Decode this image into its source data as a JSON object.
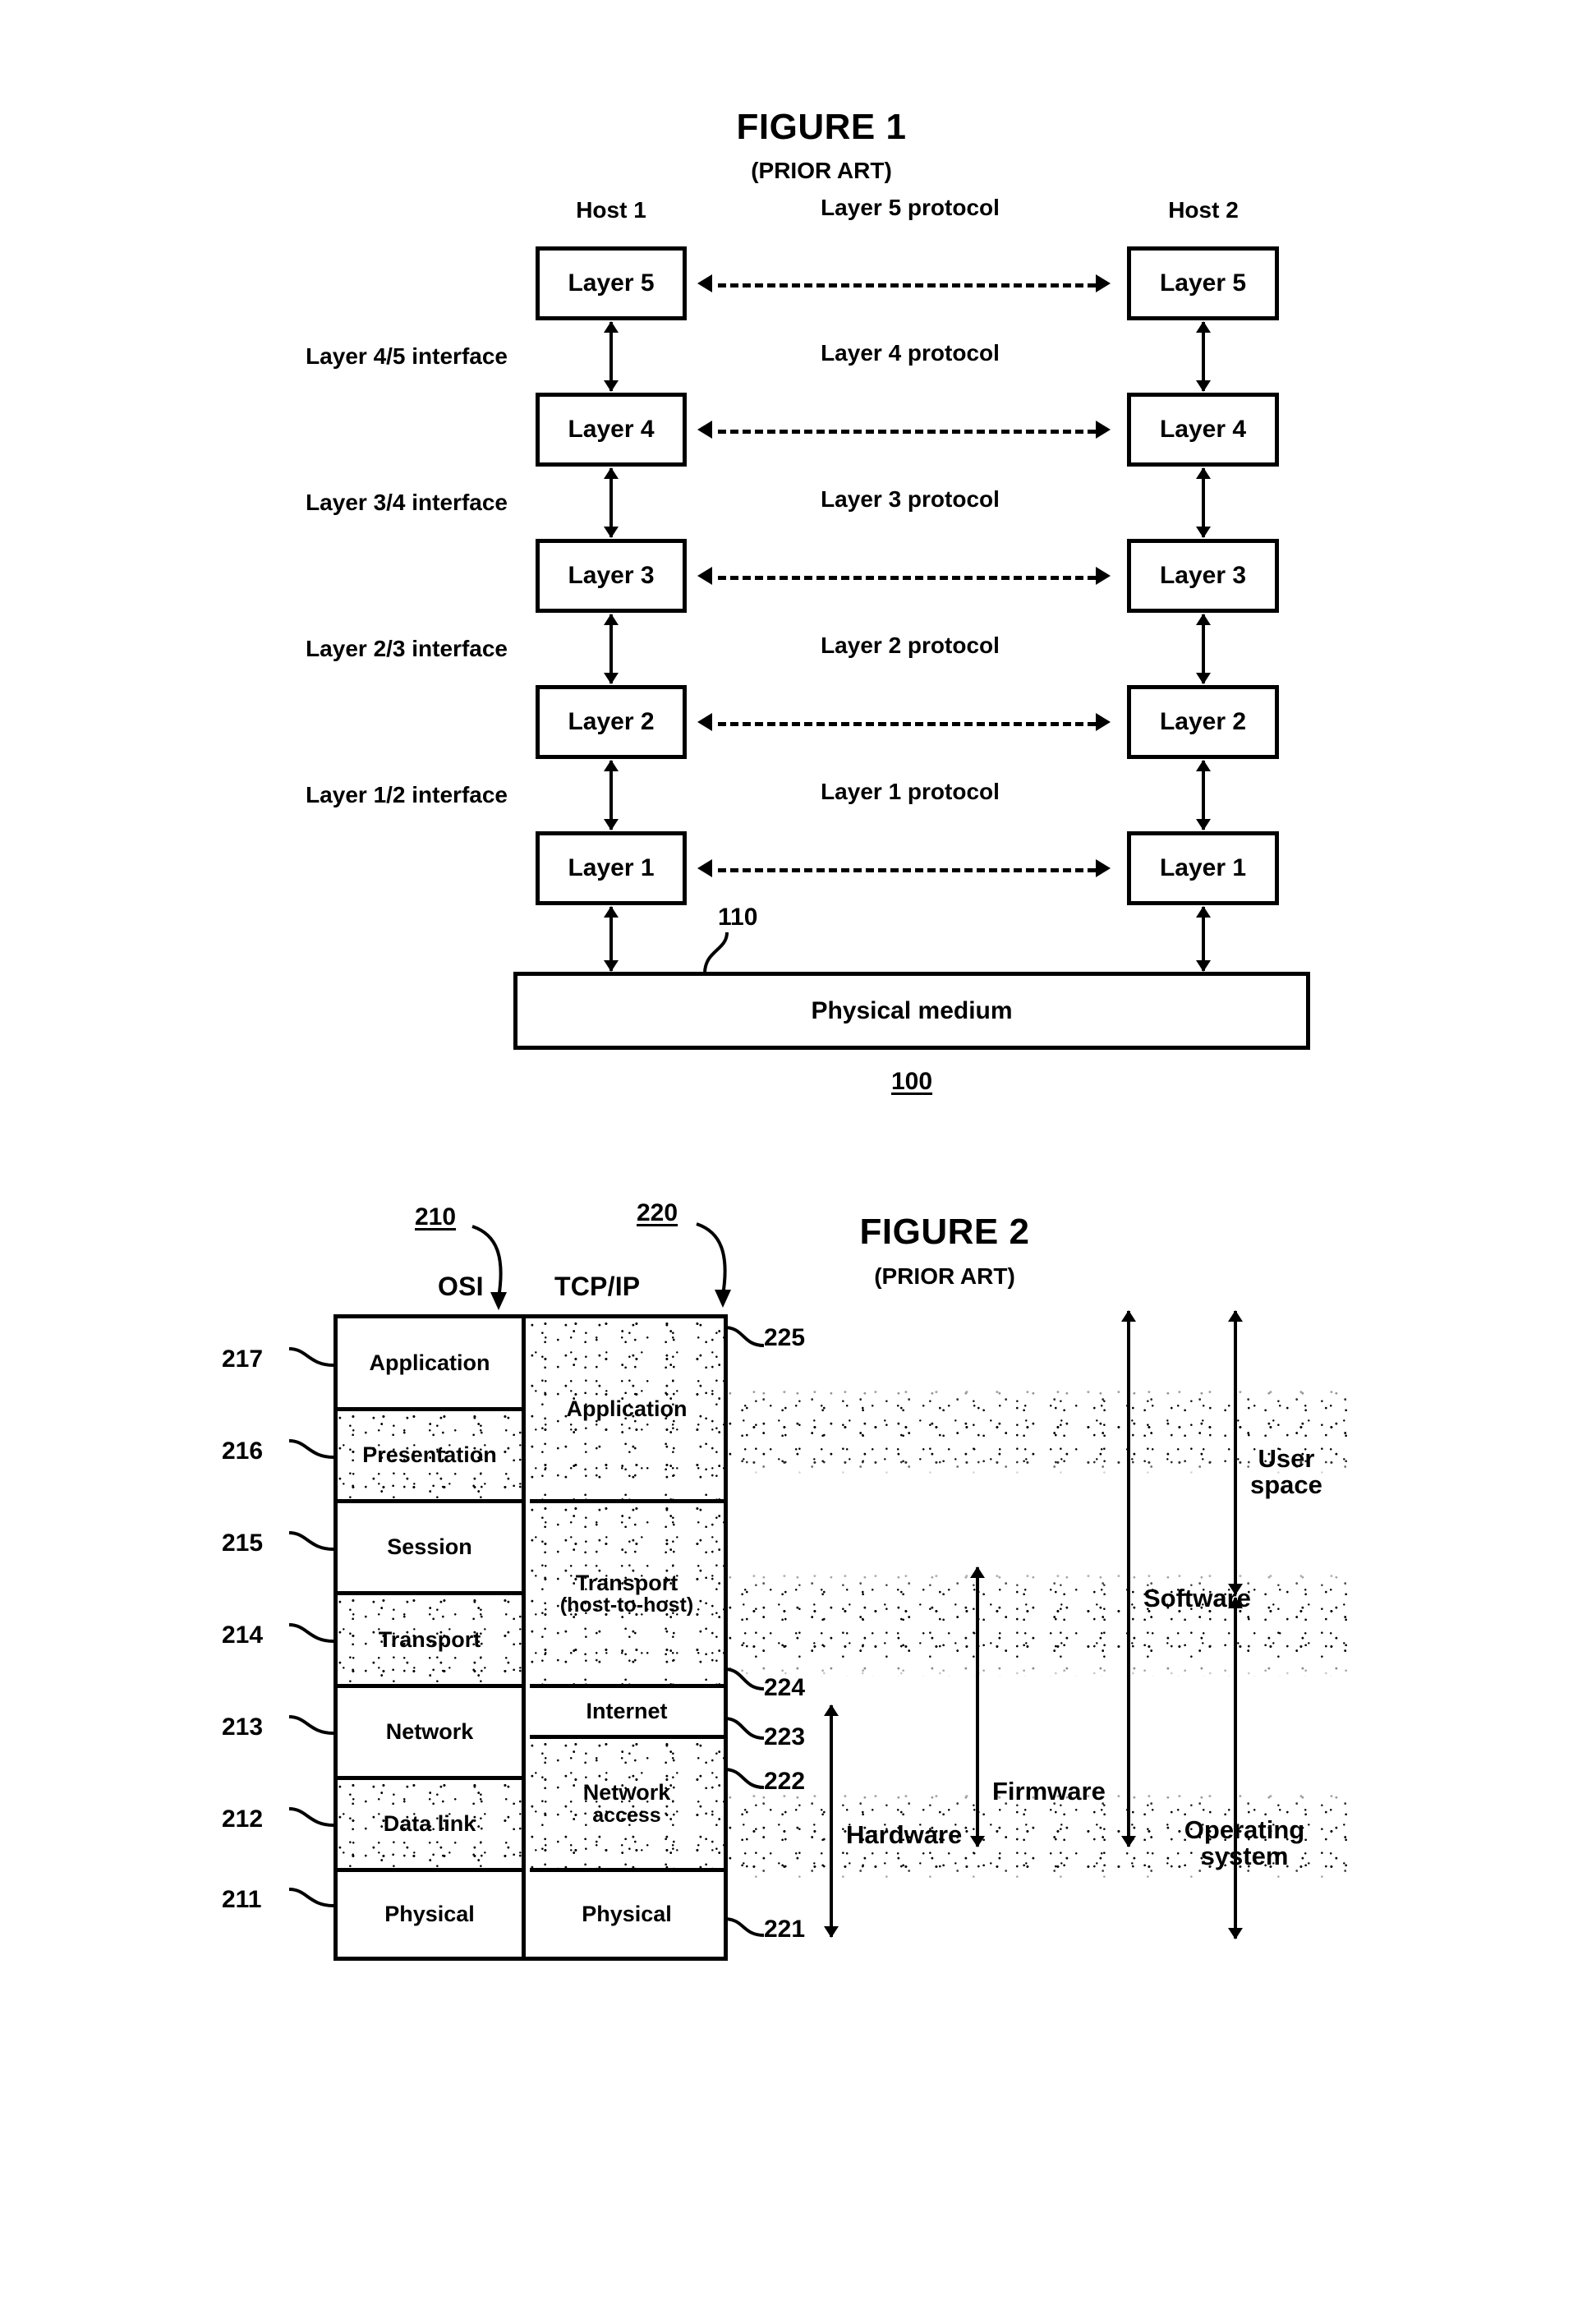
{
  "figure1": {
    "title": "FIGURE 1",
    "subtitle": "(PRIOR ART)",
    "host_left": "Host 1",
    "host_right": "Host 2",
    "layers": [
      {
        "name": "Layer 5",
        "protocol": "Layer 5 protocol"
      },
      {
        "name": "Layer 4",
        "protocol": "Layer 4 protocol"
      },
      {
        "name": "Layer 3",
        "protocol": "Layer 3 protocol"
      },
      {
        "name": "Layer 2",
        "protocol": "Layer 2 protocol"
      },
      {
        "name": "Layer 1",
        "protocol": "Layer 1 protocol"
      }
    ],
    "interfaces": [
      "Layer 4/5 interface",
      "Layer 3/4 interface",
      "Layer 2/3 interface",
      "Layer 1/2 interface"
    ],
    "medium": "Physical medium",
    "ref_medium": "110",
    "ref_system": "100"
  },
  "figure2": {
    "title": "FIGURE 2",
    "subtitle": "(PRIOR ART)",
    "col_osi": "OSI",
    "col_tcpip": "TCP/IP",
    "ref_osi": "210",
    "ref_tcpip": "220",
    "osi_layers": [
      {
        "ref": "217",
        "label": "Application",
        "shaded": false
      },
      {
        "ref": "216",
        "label": "Presentation",
        "shaded": true
      },
      {
        "ref": "215",
        "label": "Session",
        "shaded": false
      },
      {
        "ref": "214",
        "label": "Transport",
        "shaded": true
      },
      {
        "ref": "213",
        "label": "Network",
        "shaded": false
      },
      {
        "ref": "212",
        "label": "Data link",
        "shaded": true
      },
      {
        "ref": "211",
        "label": "Physical",
        "shaded": false
      }
    ],
    "tcpip_layers": [
      {
        "ref": "225",
        "label": "Application",
        "sub": "",
        "shaded": true,
        "span": 3
      },
      {
        "ref": "224",
        "label": "Transport",
        "sub": "(host-to-host)",
        "shaded": true,
        "span": 2
      },
      {
        "ref": "223",
        "label": "Internet",
        "sub": "",
        "shaded": false,
        "span": 1
      },
      {
        "ref": "222",
        "label": "Network",
        "sub": "access",
        "shaded": true,
        "span": 1
      },
      {
        "ref": "221",
        "label": "Physical",
        "sub": "",
        "shaded": false,
        "span": 1
      }
    ],
    "scope_labels": {
      "hardware": "Hardware",
      "firmware": "Firmware",
      "software": "Software",
      "user_space_line1": "User",
      "user_space_line2": "space",
      "operating_system_line1": "Operating",
      "operating_system_line2": "system"
    }
  }
}
